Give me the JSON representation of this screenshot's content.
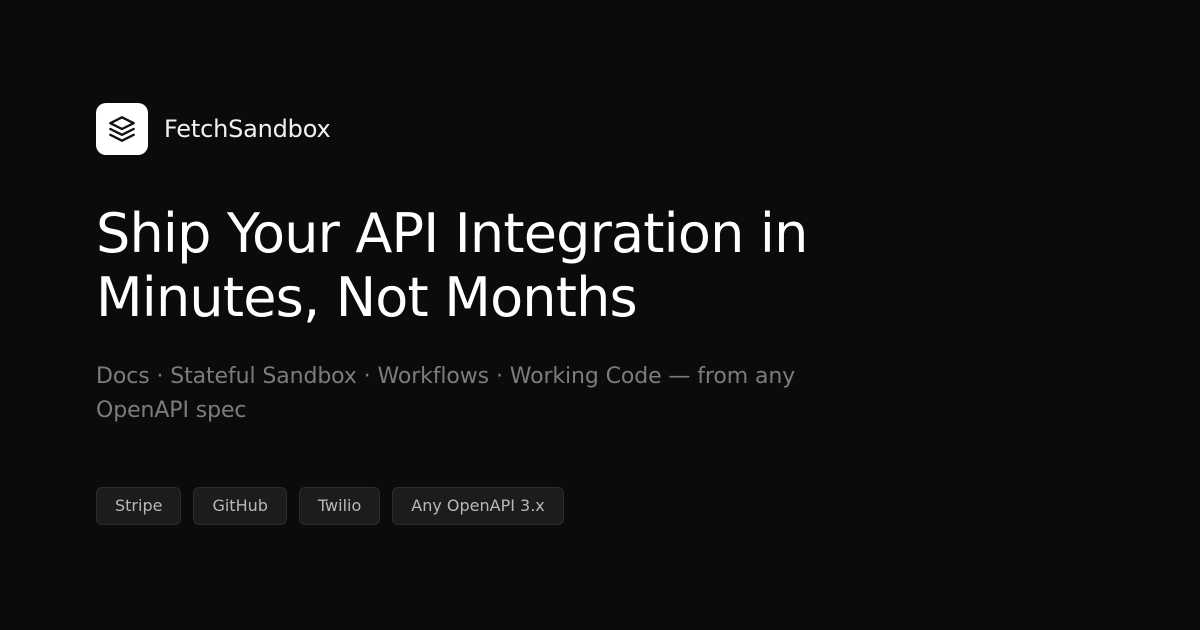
{
  "brand": {
    "name": "FetchSandbox",
    "logo_icon": "layers-icon",
    "logo_bg": "#ffffff",
    "logo_fg": "#111111"
  },
  "hero": {
    "headline_line1": "Ship Your API Integration in",
    "headline_line2": "Minutes, Not Months",
    "subtitle_line1": "Docs · Stateful Sandbox · Workflows · Working Code — from any",
    "subtitle_line2": "OpenAPI spec"
  },
  "chips": [
    {
      "label": "Stripe"
    },
    {
      "label": "GitHub"
    },
    {
      "label": "Twilio"
    },
    {
      "label": "Any OpenAPI 3.x"
    }
  ],
  "colors": {
    "background": "#0b0b0b",
    "headline": "#ffffff",
    "subtitle": "#7c7c7c",
    "chip_bg": "#1c1c1c",
    "chip_border": "#2c2c2c",
    "chip_text": "#b8b8b8"
  }
}
